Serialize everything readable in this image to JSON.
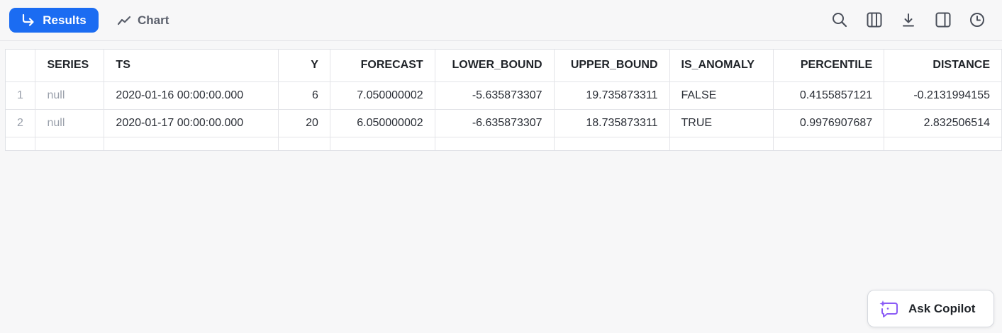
{
  "tabs": {
    "results": "Results",
    "chart": "Chart"
  },
  "toolbar_icons": [
    "search-icon",
    "columns-icon",
    "download-icon",
    "split-panel-icon",
    "history-icon"
  ],
  "colors": {
    "accent": "#1b6cf2",
    "copilot_icon": "#8b5cf6"
  },
  "table": {
    "columns": [
      "SERIES",
      "TS",
      "Y",
      "FORECAST",
      "LOWER_BOUND",
      "UPPER_BOUND",
      "IS_ANOMALY",
      "PERCENTILE",
      "DISTANCE"
    ],
    "rows": [
      {
        "num": "1",
        "cells": [
          "null",
          "2020-01-16 00:00:00.000",
          "6",
          "7.050000002",
          "-5.635873307",
          "19.735873311",
          "FALSE",
          "0.4155857121",
          "-0.2131994155"
        ]
      },
      {
        "num": "2",
        "cells": [
          "null",
          "2020-01-17 00:00:00.000",
          "20",
          "6.050000002",
          "-6.635873307",
          "18.735873311",
          "TRUE",
          "0.9976907687",
          "2.832506514"
        ]
      }
    ]
  },
  "copilot": {
    "label": "Ask Copilot"
  }
}
